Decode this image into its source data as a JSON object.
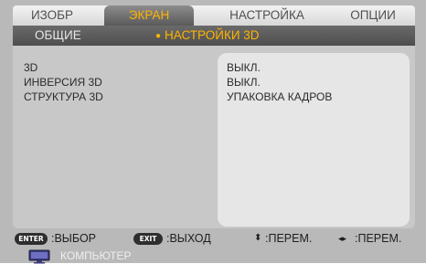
{
  "tabs": [
    {
      "label": "ИЗОБР"
    },
    {
      "label": "ЭКРАН"
    },
    {
      "label": "НАСТРОЙКА"
    },
    {
      "label": "ОПЦИИ"
    }
  ],
  "subtabs": [
    {
      "label": "ОБЩИЕ"
    },
    {
      "label": "НАСТРОЙКИ 3D"
    }
  ],
  "settings": [
    {
      "label": "3D",
      "value": "ВЫКЛ."
    },
    {
      "label": "ИНВЕРСИЯ 3D",
      "value": "ВЫКЛ."
    },
    {
      "label": "СТРУКТУРА 3D",
      "value": "УПАКОВКА КАДРОВ"
    }
  ],
  "help": {
    "enter_key": "ENTER",
    "enter_text": ":ВЫБОР",
    "exit_key": "EXIT",
    "exit_text": ":ВЫХОД",
    "updown_text": ":ПЕРЕМ.",
    "leftright_text": ":ПЕРЕМ."
  },
  "footer": {
    "source": "КОМПЬЮТЕР"
  },
  "colors": {
    "accent": "#ffb400",
    "panel": "#c8c8c8",
    "value_box": "#e6e6e6"
  }
}
